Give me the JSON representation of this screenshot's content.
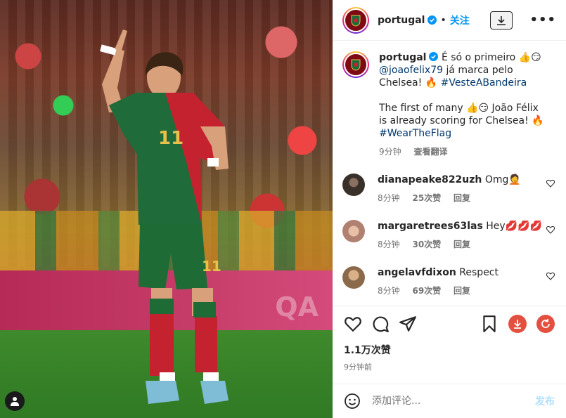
{
  "post_header": {
    "username": "portugal",
    "separator": "•",
    "follow_label": "关注",
    "more_label": "•••"
  },
  "caption": {
    "username": "portugal",
    "line1": "É só o primeiro 👍😏",
    "mention": "@joaofelix79",
    "line2": " já marca pelo Chelsea! 🔥 ",
    "hashtag1": "#VesteABandeira",
    "line3": "The first of many 👍😏 João Félix is already scoring for Chelsea! 🔥",
    "hashtag2": "#WearTheFlag",
    "time": "9分钟",
    "translate": "查看翻译"
  },
  "comments": [
    {
      "username": "dianapeake822uzh",
      "text": "Omg🤦",
      "time": "8分钟",
      "likes": "25次赞",
      "reply": "回复",
      "avatar_color": "#4a4038"
    },
    {
      "username": "margaretrees63las",
      "text": "Hey💋💋💋",
      "time": "8分钟",
      "likes": "30次赞",
      "reply": "回复",
      "avatar_color": "#c9a089"
    },
    {
      "username": "angelavfdixon",
      "text": "Respect",
      "time": "8分钟",
      "likes": "69次赞",
      "reply": "回复",
      "avatar_color": "#b08a5a"
    }
  ],
  "stats": {
    "likes": "1.1万次赞",
    "posted": "9分钟前"
  },
  "add_comment": {
    "placeholder": "添加评论...",
    "post_label": "发布"
  },
  "photo": {
    "banner_text": "QA",
    "jersey_number": "11"
  },
  "colors": {
    "accent": "#0095f6",
    "download": "#e4503f",
    "portugal_red": "#7e0b14"
  }
}
